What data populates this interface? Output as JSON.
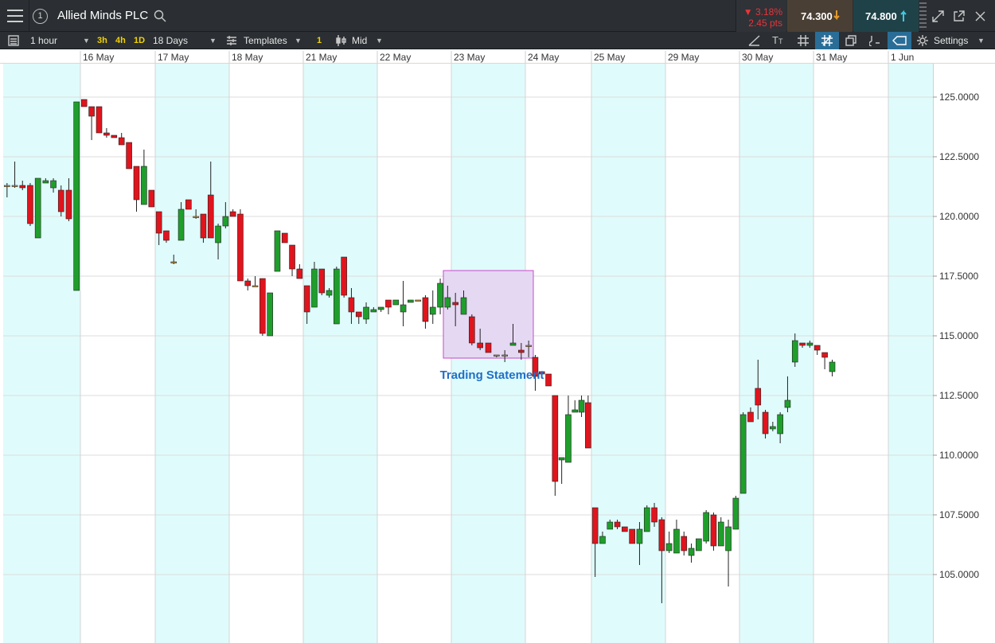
{
  "header": {
    "instrument_number": "1",
    "instrument_name": "Allied Minds PLC",
    "change_pct": "▼ 3.18%",
    "change_pts": "2.45 pts",
    "sell_price": "74.300",
    "buy_price": "74.800"
  },
  "toolbar": {
    "interval": "1 hour",
    "quick_intervals": [
      "3h",
      "4h",
      "1D"
    ],
    "range": "18 Days",
    "templates_label": "Templates",
    "indicator_count": "1",
    "price_type": "Mid",
    "settings_label": "Settings"
  },
  "colors": {
    "up_candle": "#1f9e2c",
    "down_candle": "#e0141d",
    "doji": "#d79b3a",
    "band": "#e0fbfb",
    "annotation_fill": "#e5d8f3",
    "annotation_border": "#c84ac8",
    "annotation_text": "#1f6fc8"
  },
  "icons": [
    "menu-icon",
    "search-icon",
    "arrow-down-icon",
    "arrow-up-icon",
    "expand-icon",
    "popout-icon",
    "close-icon",
    "list-icon",
    "templates-icon",
    "candle-icon",
    "draw-line-icon",
    "text-icon",
    "grid-icon",
    "crosshair-icon",
    "layers-icon",
    "pin-icon",
    "tag-icon",
    "gear-icon"
  ],
  "annotation": {
    "label": "Trading Statement"
  },
  "chart_data": {
    "type": "candlestick",
    "title": "Allied Minds PLC",
    "y_ticks": [
      125,
      122.5,
      120,
      117.5,
      115,
      112.5,
      110,
      107.5,
      105
    ],
    "y_tick_labels": [
      "125.0000",
      "122.5000",
      "120.0000",
      "117.5000",
      "115.0000",
      "112.5000",
      "110.0000",
      "107.5000",
      "105.0000"
    ],
    "ylim": [
      103.2,
      126.3
    ],
    "x_labels": [
      "16 May",
      "17 May",
      "18 May",
      "21 May",
      "22 May",
      "23 May",
      "24 May",
      "25 May",
      "29 May",
      "30 May",
      "31 May",
      "1 Jun"
    ],
    "grid": true,
    "day_sizes": [
      10,
      10,
      10,
      10,
      10,
      10,
      9,
      10,
      10,
      10,
      10,
      10,
      6
    ],
    "candles": [
      [
        121.3,
        121.3,
        121.4,
        120.8
      ],
      [
        121.3,
        121.3,
        122.3,
        121.2
      ],
      [
        121.3,
        121.2,
        121.5,
        121.1
      ],
      [
        121.3,
        119.7,
        121.4,
        119.6
      ],
      [
        119.1,
        121.6,
        121.6,
        119.1
      ],
      [
        121.4,
        121.5,
        121.6,
        121.4
      ],
      [
        121.2,
        121.5,
        121.6,
        121.0
      ],
      [
        121.1,
        120.2,
        121.3,
        120.0
      ],
      [
        121.1,
        119.9,
        121.6,
        119.8
      ],
      [
        116.9,
        124.8,
        124.8,
        116.9
      ],
      [
        124.9,
        124.6,
        124.9,
        124.6
      ],
      [
        124.6,
        124.2,
        124.6,
        123.2
      ],
      [
        124.6,
        123.5,
        124.6,
        123.5
      ],
      [
        123.5,
        123.4,
        123.7,
        123.3
      ],
      [
        123.4,
        123.3,
        123.4,
        123.3
      ],
      [
        123.3,
        123.0,
        123.5,
        123.0
      ],
      [
        123.1,
        122.0,
        123.1,
        122.0
      ],
      [
        122.1,
        120.7,
        122.1,
        120.2
      ],
      [
        120.5,
        122.1,
        122.8,
        120.5
      ],
      [
        121.1,
        120.4,
        121.1,
        120.4
      ],
      [
        120.2,
        119.3,
        120.2,
        118.8
      ],
      [
        119.4,
        119.0,
        119.4,
        118.9
      ],
      [
        118.1,
        118.1,
        118.4,
        118.0
      ],
      [
        119.0,
        120.3,
        120.6,
        119.0
      ],
      [
        120.7,
        120.3,
        120.7,
        120.3
      ],
      [
        120.0,
        120.0,
        120.3,
        119.9
      ],
      [
        120.1,
        119.1,
        120.1,
        118.9
      ],
      [
        120.9,
        119.1,
        122.3,
        119.1
      ],
      [
        118.9,
        119.6,
        119.7,
        118.2
      ],
      [
        119.6,
        120.0,
        120.6,
        119.5
      ],
      [
        120.2,
        120.0,
        120.3,
        120.0
      ],
      [
        120.1,
        117.3,
        120.3,
        117.3
      ],
      [
        117.3,
        117.1,
        117.4,
        116.9
      ],
      [
        117.1,
        117.1,
        117.5,
        117.1
      ],
      [
        117.4,
        115.1,
        117.4,
        115.0
      ],
      [
        115.0,
        116.8,
        116.8,
        115.0
      ],
      [
        117.7,
        119.4,
        119.4,
        117.7
      ],
      [
        119.3,
        118.9,
        119.3,
        118.9
      ],
      [
        118.8,
        117.8,
        118.8,
        117.5
      ],
      [
        117.8,
        117.4,
        118.0,
        117.4
      ],
      [
        117.1,
        116.0,
        117.1,
        115.5
      ],
      [
        116.2,
        117.8,
        118.1,
        116.2
      ],
      [
        117.8,
        116.8,
        117.8,
        116.7
      ],
      [
        116.7,
        116.9,
        117.0,
        116.6
      ],
      [
        115.5,
        117.8,
        117.9,
        115.5
      ],
      [
        118.3,
        116.7,
        118.3,
        116.6
      ],
      [
        116.6,
        116.0,
        117.0,
        115.5
      ],
      [
        116.0,
        115.8,
        116.0,
        115.5
      ],
      [
        115.7,
        116.2,
        116.4,
        115.5
      ],
      [
        116.0,
        116.1,
        116.2,
        116.0
      ],
      [
        116.1,
        116.2,
        116.2,
        116.0
      ],
      [
        116.5,
        116.2,
        116.5,
        115.9
      ],
      [
        116.3,
        116.5,
        116.5,
        116.3
      ],
      [
        116.0,
        116.3,
        117.3,
        115.4
      ],
      [
        116.4,
        116.5,
        116.5,
        116.4
      ],
      [
        116.5,
        116.5,
        116.5,
        116.5
      ],
      [
        116.6,
        115.6,
        116.7,
        115.3
      ],
      [
        115.9,
        116.2,
        116.9,
        115.5
      ],
      [
        116.2,
        117.2,
        117.4,
        115.9
      ],
      [
        116.2,
        116.6,
        117.1,
        116.1
      ],
      [
        116.4,
        116.3,
        116.8,
        115.4
      ],
      [
        115.9,
        116.6,
        116.9,
        115.9
      ],
      [
        115.8,
        114.7,
        115.9,
        114.6
      ],
      [
        114.7,
        114.5,
        115.3,
        114.4
      ],
      [
        114.7,
        114.3,
        114.7,
        114.3
      ],
      [
        114.2,
        114.2,
        114.2,
        114.1
      ],
      [
        114.2,
        114.2,
        114.4,
        113.9
      ],
      [
        114.6,
        114.7,
        115.5,
        114.6
      ],
      [
        114.4,
        114.3,
        114.7,
        114.0
      ],
      [
        114.6,
        114.6,
        114.8,
        114.1
      ],
      [
        114.1,
        113.3,
        114.2,
        112.7
      ],
      [
        113.5,
        113.4,
        113.5,
        113.3
      ],
      [
        113.4,
        112.9,
        113.4,
        112.9
      ],
      [
        112.5,
        108.9,
        112.5,
        108.3
      ],
      [
        109.8,
        109.9,
        109.9,
        108.8
      ],
      [
        109.7,
        111.7,
        112.5,
        109.7
      ],
      [
        111.8,
        111.9,
        112.3,
        111.8
      ],
      [
        111.8,
        112.3,
        112.5,
        111.6
      ],
      [
        112.2,
        110.3,
        112.5,
        110.3
      ],
      [
        107.8,
        106.3,
        107.8,
        104.9
      ],
      [
        106.3,
        106.6,
        106.8,
        106.3
      ],
      [
        106.9,
        107.2,
        107.3,
        106.9
      ],
      [
        107.2,
        107.0,
        107.3,
        106.9
      ],
      [
        107.0,
        106.8,
        107.0,
        106.8
      ],
      [
        106.9,
        106.3,
        106.9,
        106.3
      ],
      [
        106.3,
        106.9,
        107.2,
        105.4
      ],
      [
        106.8,
        107.8,
        107.9,
        106.8
      ],
      [
        107.8,
        107.2,
        108.0,
        107.0
      ],
      [
        107.3,
        106.0,
        107.4,
        103.8
      ],
      [
        106.0,
        106.3,
        106.8,
        105.9
      ],
      [
        105.9,
        106.9,
        107.3,
        105.9
      ],
      [
        106.6,
        106.0,
        106.8,
        105.8
      ],
      [
        105.8,
        106.1,
        106.3,
        105.5
      ],
      [
        106.0,
        106.5,
        106.5,
        106.0
      ],
      [
        106.4,
        107.6,
        107.7,
        106.3
      ],
      [
        107.5,
        106.2,
        107.6,
        106.0
      ],
      [
        106.2,
        107.2,
        107.4,
        106.2
      ],
      [
        106.0,
        107.0,
        107.3,
        104.5
      ],
      [
        106.9,
        108.2,
        108.3,
        106.9
      ],
      [
        108.4,
        111.7,
        111.8,
        108.4
      ],
      [
        111.8,
        111.4,
        112.0,
        111.4
      ],
      [
        112.8,
        112.1,
        114.0,
        111.5
      ],
      [
        111.8,
        110.9,
        111.9,
        110.7
      ],
      [
        111.1,
        111.2,
        111.4,
        111.0
      ],
      [
        110.9,
        111.7,
        111.8,
        110.5
      ],
      [
        112.0,
        112.3,
        113.3,
        111.8
      ],
      [
        113.9,
        114.8,
        115.1,
        113.7
      ],
      [
        114.7,
        114.6,
        114.7,
        114.5
      ],
      [
        114.6,
        114.7,
        114.8,
        114.5
      ],
      [
        114.6,
        114.4,
        114.6,
        114.2
      ],
      [
        114.3,
        114.1,
        114.3,
        113.6
      ],
      [
        113.5,
        113.9,
        114.0,
        113.3
      ]
    ]
  }
}
